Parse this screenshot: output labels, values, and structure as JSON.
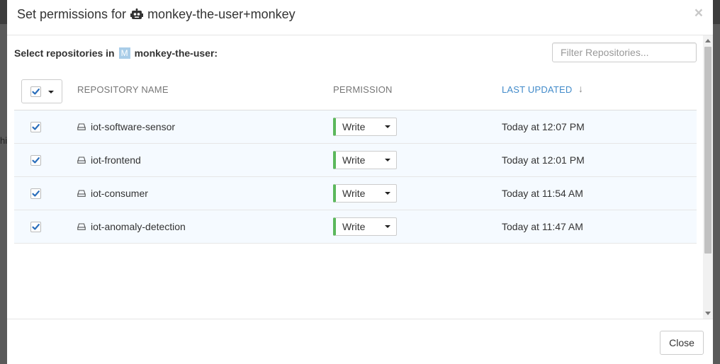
{
  "backdrop": {
    "partial_text": "hi"
  },
  "modal": {
    "title_prefix": "Set permissions for",
    "title_account": "monkey-the-user+monkey",
    "title_icon": "robot-icon",
    "close_symbol": "×"
  },
  "body": {
    "select_label": "Select repositories in",
    "org_badge": "M",
    "org_name": "monkey-the-user",
    "org_suffix": ":",
    "filter_placeholder": "Filter Repositories..."
  },
  "table": {
    "columns": {
      "name": "REPOSITORY NAME",
      "permission": "PERMISSION",
      "updated": "LAST UPDATED",
      "sort_symbol": "↓"
    },
    "bulk_checked": true,
    "rows": [
      {
        "name": "iot-software-sensor",
        "permission": "Write",
        "updated": "Today at 12:07 PM",
        "checked": true
      },
      {
        "name": "iot-frontend",
        "permission": "Write",
        "updated": "Today at 12:01 PM",
        "checked": true
      },
      {
        "name": "iot-consumer",
        "permission": "Write",
        "updated": "Today at 11:54 AM",
        "checked": true
      },
      {
        "name": "iot-anomaly-detection",
        "permission": "Write",
        "updated": "Today at 11:47 AM",
        "checked": true
      }
    ]
  },
  "footer": {
    "close_label": "Close"
  },
  "colors": {
    "accent": "#428bca",
    "write_permission": "#5cb85c",
    "check": "#2a6ebb"
  }
}
